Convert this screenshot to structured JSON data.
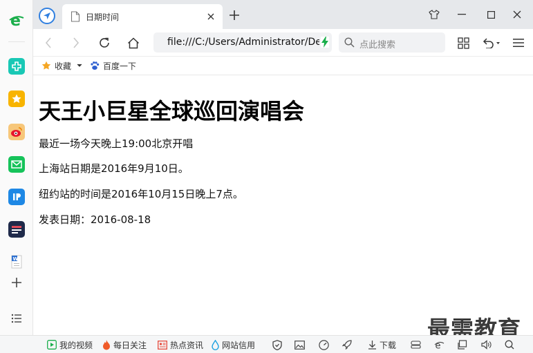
{
  "tab": {
    "title": "日期时间"
  },
  "toolbar": {
    "url": "file:///C:/Users/Administrator/Desktop",
    "search_placeholder": "点此搜索"
  },
  "bookmarks": [
    {
      "label": "收藏"
    },
    {
      "label": "百度一下"
    }
  ],
  "page": {
    "heading": "天王小巨星全球巡回演唱会",
    "paragraphs": [
      "最近一场今天晚上19:00北京开唱",
      "上海站日期是2016年9月10日。",
      "纽约站的时间是2016年10月15日晚上7点。",
      "发表日期：2016-08-18"
    ]
  },
  "watermark": "最需教育",
  "statusbar": {
    "items": [
      {
        "label": "我的视频"
      },
      {
        "label": "每日关注"
      },
      {
        "label": "热点资讯"
      },
      {
        "label": "网站信用"
      },
      {
        "label": "下载"
      }
    ]
  },
  "colors": {
    "accent": "#2f7fe0",
    "tabstrip_bg": "#e6e8eb",
    "green": "#1aae4b",
    "star": "#f5a623"
  },
  "icons": {
    "sidebar": [
      "ie-logo-icon",
      "health-cross-icon",
      "favorites-star-icon",
      "weibo-icon",
      "mail-icon",
      "ip-app-icon",
      "news-app-icon",
      "word-doc-icon",
      "add-icon",
      "list-menu-icon"
    ],
    "toolbar": [
      "back-icon",
      "forward-icon",
      "refresh-icon",
      "home-icon",
      "grid-apps-icon",
      "undo-icon",
      "menu-icon"
    ],
    "window": [
      "skin-shirt-icon",
      "minimize-icon",
      "maximize-icon",
      "close-icon"
    ]
  }
}
